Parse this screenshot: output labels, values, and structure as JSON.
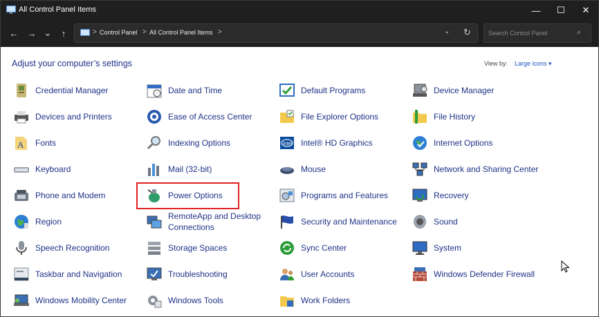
{
  "window": {
    "title": "All Control Panel Items",
    "controls": {
      "minimize": "—",
      "maximize": "☐",
      "close": "✕"
    }
  },
  "nav": {
    "back": "←",
    "forward": "→",
    "recent": "⌄",
    "up": "↑",
    "breadcrumb": [
      "Control Panel",
      "All Control Panel Items"
    ],
    "separator": ">",
    "dropdown": "⌄",
    "refresh": "↻"
  },
  "search": {
    "placeholder": "Search Control Panel",
    "icon": "search-icon"
  },
  "header": {
    "heading": "Adjust your computer’s settings",
    "view_by_label": "View by:",
    "view_by_value": "Large icons ▾"
  },
  "items": [
    [
      {
        "label": "Credential Manager",
        "icon": "credential-icon"
      },
      {
        "label": "Devices and Printers",
        "icon": "printer-icon"
      },
      {
        "label": "Fonts",
        "icon": "fonts-icon"
      },
      {
        "label": "Keyboard",
        "icon": "keyboard-icon"
      },
      {
        "label": "Phone and Modem",
        "icon": "phone-icon"
      },
      {
        "label": "Region",
        "icon": "globe-icon"
      },
      {
        "label": "Speech Recognition",
        "icon": "microphone-icon"
      },
      {
        "label": "Taskbar and Navigation",
        "icon": "taskbar-icon"
      },
      {
        "label": "Windows Mobility Center",
        "icon": "mobility-icon"
      }
    ],
    [
      {
        "label": "Date and Time",
        "icon": "calendar-icon"
      },
      {
        "label": "Ease of Access Center",
        "icon": "accessibility-icon"
      },
      {
        "label": "Indexing Options",
        "icon": "magnifier-icon"
      },
      {
        "label": "Mail (32-bit)",
        "icon": "mail-icon"
      },
      {
        "label": "Power Options",
        "icon": "power-icon"
      },
      {
        "label": "RemoteApp and Desktop Connections",
        "icon": "remote-icon"
      },
      {
        "label": "Storage Spaces",
        "icon": "storage-icon"
      },
      {
        "label": "Troubleshooting",
        "icon": "troubleshoot-icon"
      },
      {
        "label": "Windows Tools",
        "icon": "tools-icon"
      }
    ],
    [
      {
        "label": "Default Programs",
        "icon": "default-programs-icon"
      },
      {
        "label": "File Explorer Options",
        "icon": "folder-options-icon"
      },
      {
        "label": "Intel® HD Graphics",
        "icon": "intel-icon"
      },
      {
        "label": "Mouse",
        "icon": "mouse-icon"
      },
      {
        "label": "Programs and Features",
        "icon": "programs-icon"
      },
      {
        "label": "Security and Maintenance",
        "icon": "flag-icon"
      },
      {
        "label": "Sync Center",
        "icon": "sync-icon"
      },
      {
        "label": "User Accounts",
        "icon": "users-icon"
      },
      {
        "label": "Work Folders",
        "icon": "work-folders-icon"
      }
    ],
    [
      {
        "label": "Device Manager",
        "icon": "device-manager-icon"
      },
      {
        "label": "File History",
        "icon": "file-history-icon"
      },
      {
        "label": "Internet Options",
        "icon": "internet-icon"
      },
      {
        "label": "Network and Sharing Center",
        "icon": "network-icon"
      },
      {
        "label": "Recovery",
        "icon": "recovery-icon"
      },
      {
        "label": "Sound",
        "icon": "speaker-icon"
      },
      {
        "label": "System",
        "icon": "monitor-icon"
      },
      {
        "label": "Windows Defender Firewall",
        "icon": "firewall-icon"
      }
    ]
  ],
  "colors": {
    "link": "#1e3287",
    "highlight": "#e02020",
    "titlebar": "#1f1f1f"
  }
}
